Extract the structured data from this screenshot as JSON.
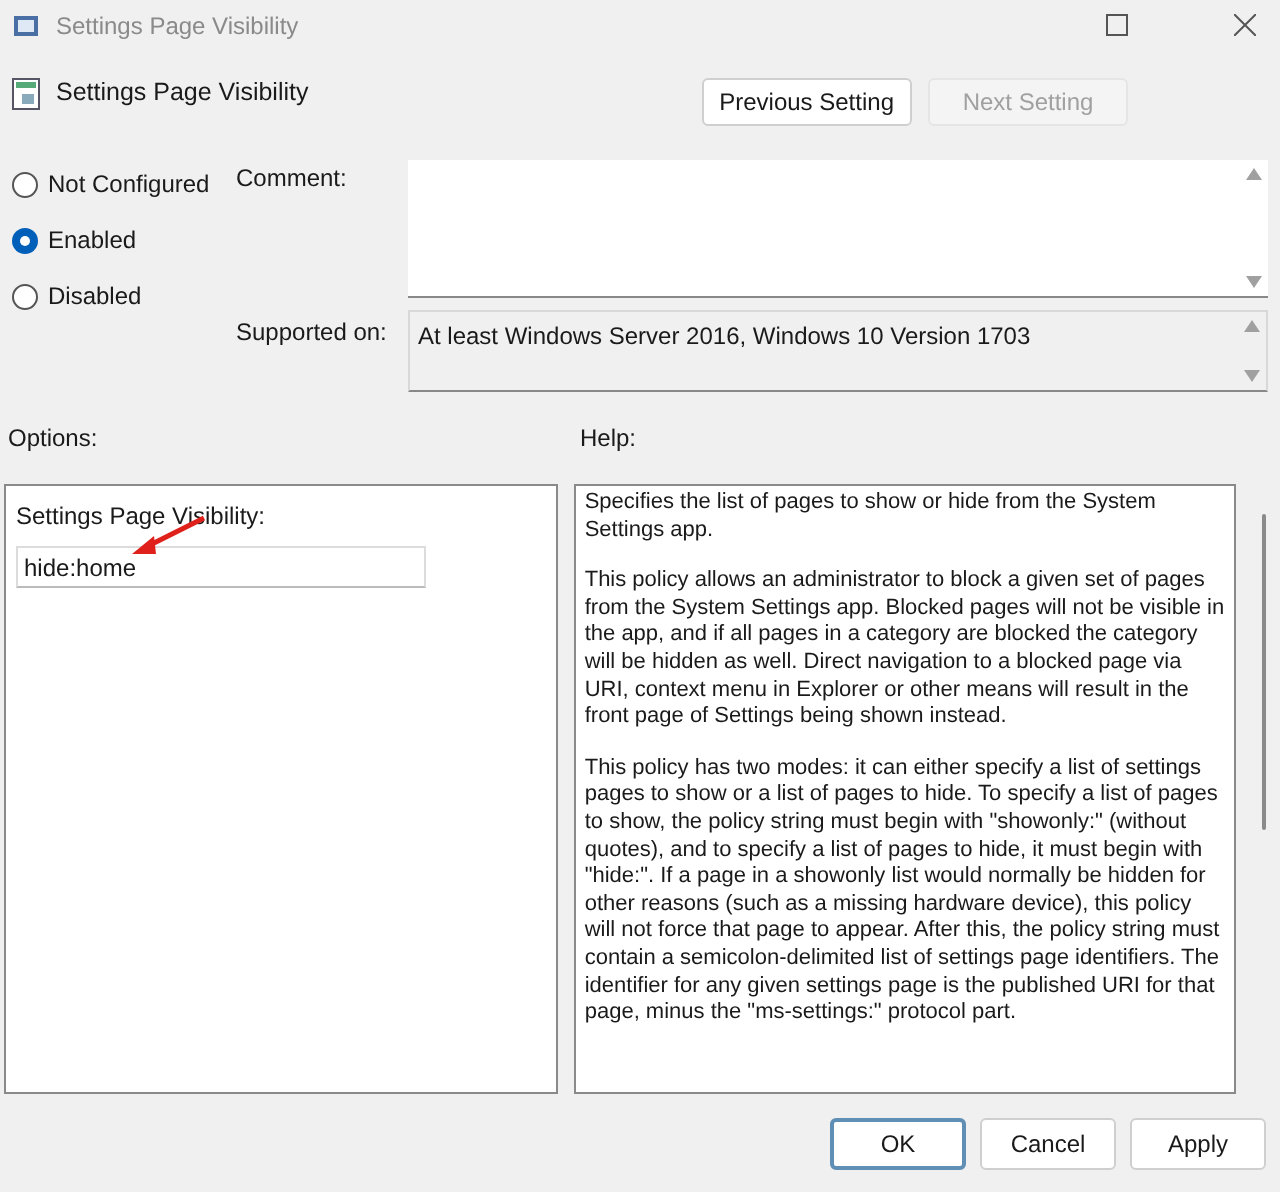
{
  "window": {
    "title": "Settings Page Visibility"
  },
  "header": {
    "title": "Settings Page Visibility",
    "buttons": [
      {
        "label": "Previous Setting",
        "disabled": false
      },
      {
        "label": "Next Setting",
        "disabled": true
      }
    ]
  },
  "state_options": [
    {
      "label": "Not Configured",
      "selected": false
    },
    {
      "label": "Enabled",
      "selected": true
    },
    {
      "label": "Disabled",
      "selected": false
    }
  ],
  "comment": {
    "label": "Comment:"
  },
  "supported_on": {
    "label": "Supported on:",
    "value": "At least Windows Server 2016, Windows 10 Version 1703"
  },
  "options": {
    "label": "Options:",
    "field_label": "Settings Page Visibility:",
    "value": "hide:home"
  },
  "help": {
    "label": "Help:",
    "paragraphs": [
      "Specifies the list of pages to show or hide from the System Settings app.",
      "This policy allows an administrator to block a given set of pages from the System Settings app. Blocked pages will not be visible in the app, and if all pages in a category are blocked the category will be hidden as well. Direct navigation to a blocked page via URI, context menu in Explorer or other means will result in the front page of Settings being shown instead.",
      "This policy has two modes: it can either specify a list of settings pages to show or a list of pages to hide. To specify a list of pages to show, the policy string must begin with \"showonly:\" (without quotes), and to specify a list of pages to hide, it must begin with \"hide:\". If a page in a showonly list would normally be hidden for other reasons (such as a missing hardware device), this policy will not force that page to appear. After this, the policy string must contain a semicolon-delimited list of settings page identifiers. The identifier for any given settings page is the published URI for that page, minus the \"ms-settings:\" protocol part."
    ]
  },
  "footer_buttons": [
    {
      "label": "OK",
      "selected": true
    },
    {
      "label": "Cancel",
      "selected": false
    },
    {
      "label": "Apply",
      "selected": false
    }
  ]
}
